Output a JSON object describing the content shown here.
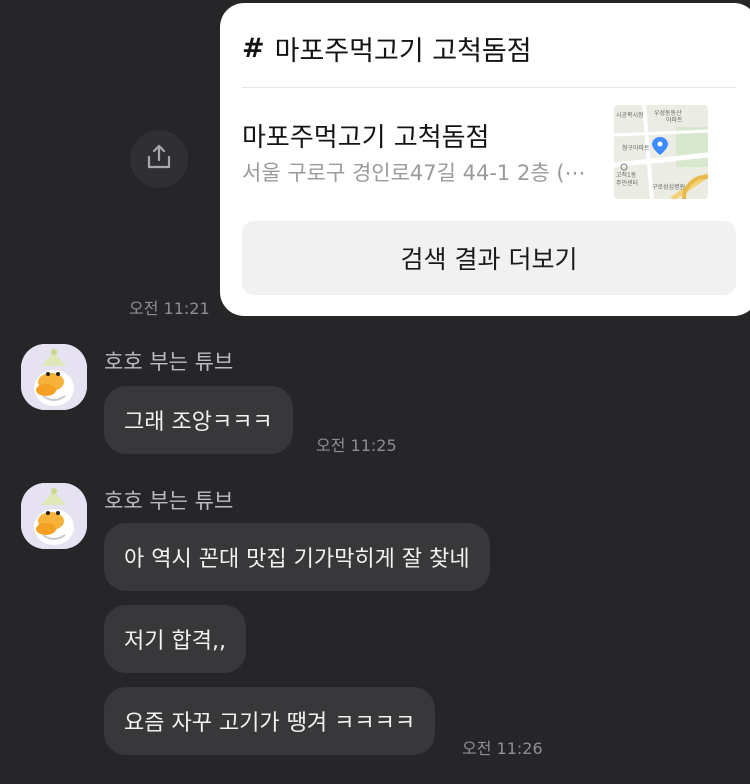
{
  "card": {
    "title": "마포주먹고기 고척돔점",
    "place_name": "마포주먹고기 고척돔점",
    "address": "서울 구로구 경인로47길 44-1 2층 (⋯",
    "more_button": "검색 결과 더보기",
    "map_labels": [
      "시공목시장",
      "우성동동산",
      "아파트",
      "청구아파트",
      "고척1동",
      "주민센터",
      "구로성심병원"
    ]
  },
  "share_time": "오전 11:21",
  "messages": [
    {
      "sender": "호호 부는 튜브",
      "bubbles": [
        "그래 조앙ㅋㅋㅋ"
      ],
      "time": "오전 11:25"
    },
    {
      "sender": "호호 부는 튜브",
      "bubbles": [
        "아 역시 꼰대 맛집 기가막히게 잘 찾네",
        "저기 합격,,",
        "요즘 자꾸 고기가 땡겨 ㅋㅋㅋㅋ"
      ],
      "time": "오전 11:26"
    }
  ],
  "colors": {
    "background": "#262628",
    "bubble": "#38383b",
    "card": "#ffffff",
    "map_pin": "#3d8bff"
  }
}
